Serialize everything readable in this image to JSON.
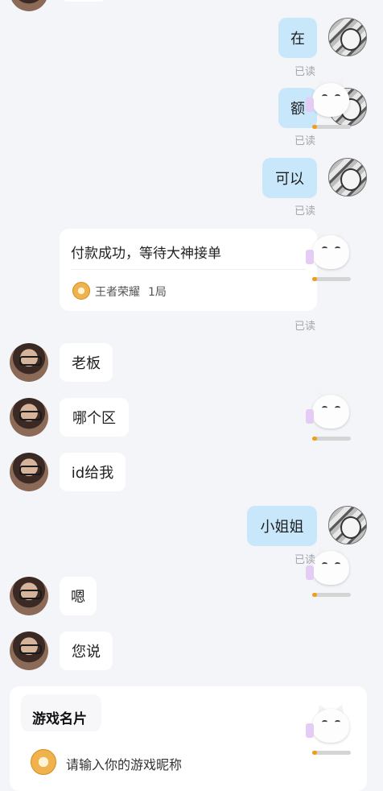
{
  "messages": {
    "m1": "在",
    "m2": "额",
    "m3": "可以",
    "m4": "老板",
    "m5": "哪个区",
    "m6": "id给我",
    "m7": "小姐姐",
    "m8": "嗯",
    "m9": "您说"
  },
  "read_label": "已读",
  "order_card": {
    "title": "付款成功，等待大神接单",
    "game": "王者荣耀",
    "rounds": "1局"
  },
  "game_card": {
    "title": "游戏名片",
    "placeholder": "请输入你的游戏昵称"
  }
}
